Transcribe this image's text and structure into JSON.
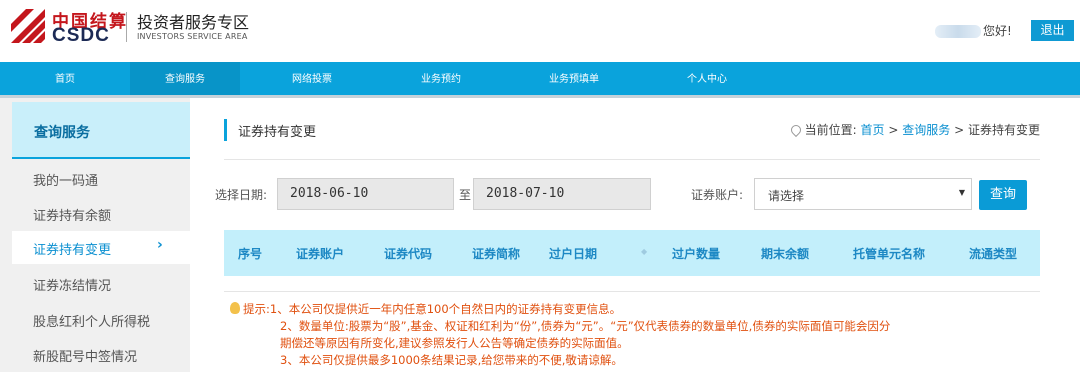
{
  "header": {
    "logo_cn": "中国结算",
    "logo_en": "CSDC",
    "title": "投资者服务专区",
    "subtitle": "INVESTORS SERVICE AREA",
    "greeting": "您好!",
    "logout_label": "退出"
  },
  "nav": {
    "items": [
      {
        "label": "首页"
      },
      {
        "label": "查询服务"
      },
      {
        "label": "网络投票"
      },
      {
        "label": "业务预约"
      },
      {
        "label": "业务预填单"
      },
      {
        "label": "个人中心"
      }
    ],
    "active_index": 1
  },
  "sidebar": {
    "heading": "查询服务",
    "items": [
      {
        "label": "我的一码通"
      },
      {
        "label": "证券持有余额"
      },
      {
        "label": "证券持有变更"
      },
      {
        "label": "证券冻结情况"
      },
      {
        "label": "股息红利个人所得税"
      },
      {
        "label": "新股配号中签情况"
      }
    ],
    "active_index": 2,
    "active_chevron": "›"
  },
  "main": {
    "page_title": "证券持有变更",
    "breadcrumb": {
      "prefix": "当前位置:",
      "home": "首页",
      "sep": ">",
      "section": "查询服务",
      "current": "证券持有变更"
    },
    "filters": {
      "date_label": "选择日期:",
      "start_date": "2018-06-10",
      "to_label": "至",
      "end_date": "2018-07-10",
      "account_label": "证券账户:",
      "account_value": "请选择",
      "query_label": "查询"
    },
    "table": {
      "columns": [
        "序号",
        "证券账户",
        "证券代码",
        "证券简称",
        "过户日期",
        "过户数量",
        "期末余额",
        "托管单元名称",
        "流通类型"
      ],
      "rows": []
    },
    "tips": {
      "label": "提示:",
      "lines": [
        "1、本公司仅提供近一年内任意100个自然日内的证券持有变更信息。",
        "2、数量单位:股票为“股”,基金、权证和红利为“份”,债券为“元”。“元”仅代表债券的数量单位,债券的实际面值可能会因分",
        "期偿还等原因有所变化,建议参照发行人公告等确定债券的实际面值。",
        "3、本公司仅提供最多1000条结果记录,给您带来的不便,敬请谅解。"
      ]
    }
  },
  "colors": {
    "brand_blue": "#0aa3dc",
    "brand_red": "#c4161c",
    "table_head_bg": "#c3effb",
    "tip_text": "#e0500f"
  }
}
